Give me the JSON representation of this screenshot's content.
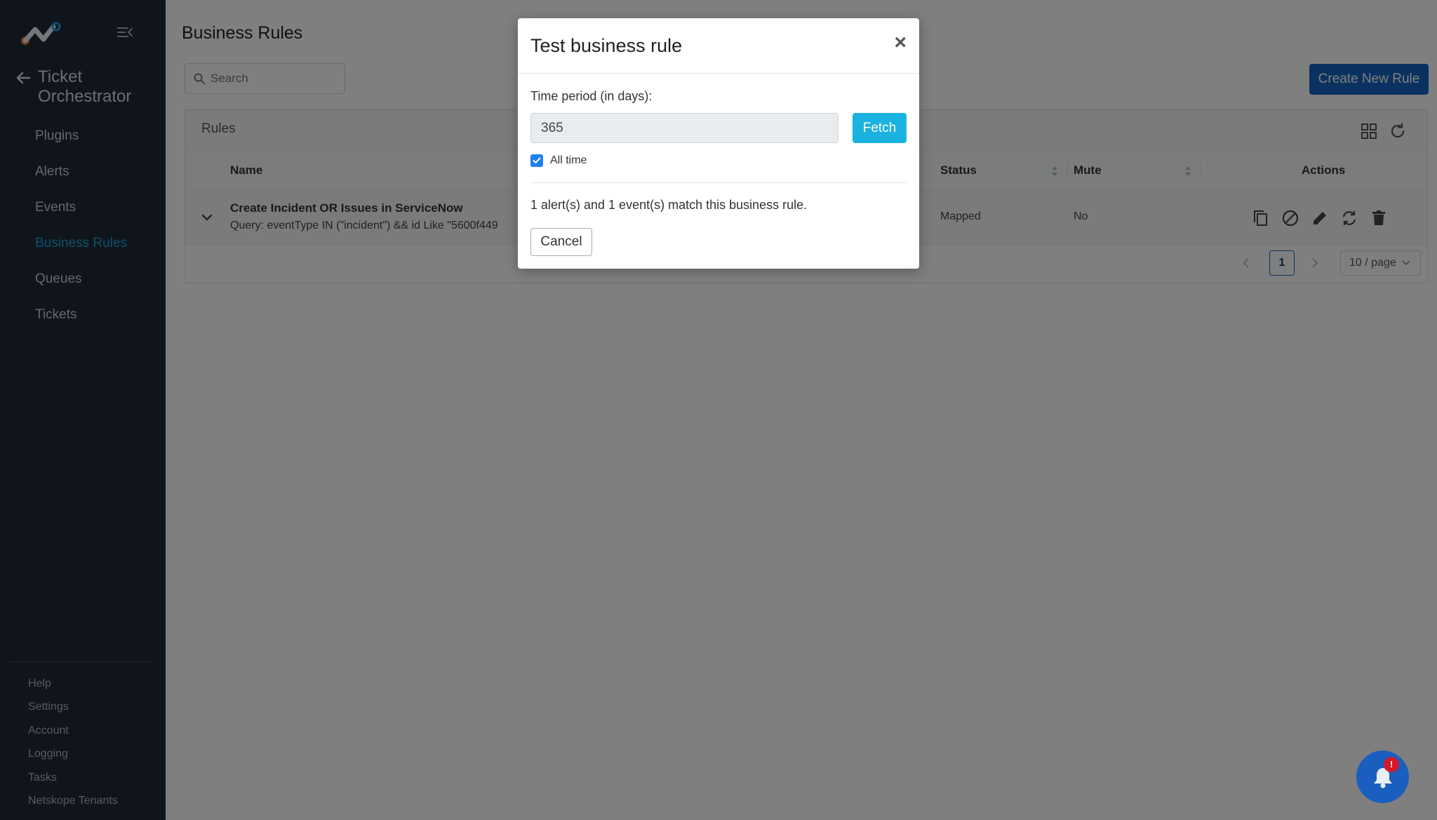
{
  "sidebar": {
    "app_title": "Ticket Orchestrator",
    "nav": [
      {
        "label": "Plugins",
        "active": false
      },
      {
        "label": "Alerts",
        "active": false
      },
      {
        "label": "Events",
        "active": false
      },
      {
        "label": "Business Rules",
        "active": true
      },
      {
        "label": "Queues",
        "active": false
      },
      {
        "label": "Tickets",
        "active": false
      }
    ],
    "footer": [
      {
        "label": "Help"
      },
      {
        "label": "Settings"
      },
      {
        "label": "Account"
      },
      {
        "label": "Logging"
      },
      {
        "label": "Tasks"
      },
      {
        "label": "Netskope Tenants"
      }
    ]
  },
  "page": {
    "title": "Business Rules",
    "search_placeholder": "Search",
    "create_button": "Create New Rule"
  },
  "rules_card": {
    "title": "Rules",
    "columns": {
      "name": "Name",
      "status": "Status",
      "mute": "Mute",
      "actions": "Actions"
    },
    "rows": [
      {
        "name": "Create Incident OR Issues in ServiceNow",
        "query": "Query: eventType IN (\"incident\") && id Like \"5600f449",
        "status": "Mapped",
        "mute": "No"
      }
    ],
    "pagination": {
      "current_page": "1",
      "page_size": "10 / page"
    }
  },
  "modal": {
    "title": "Test business rule",
    "close": "×",
    "period_label": "Time period (in days):",
    "period_value": "365",
    "fetch_button": "Fetch",
    "all_time_label": "All time",
    "all_time_checked": true,
    "match_text": "1 alert(s) and 1 event(s) match this business rule.",
    "cancel_button": "Cancel"
  },
  "notifications": {
    "badge": "!"
  },
  "colors": {
    "sidebar_bg": "#1f2a36",
    "accent": "#1ea1d8",
    "primary": "#1565c0",
    "fetch": "#1ab2e0",
    "badge": "#d4182a"
  }
}
